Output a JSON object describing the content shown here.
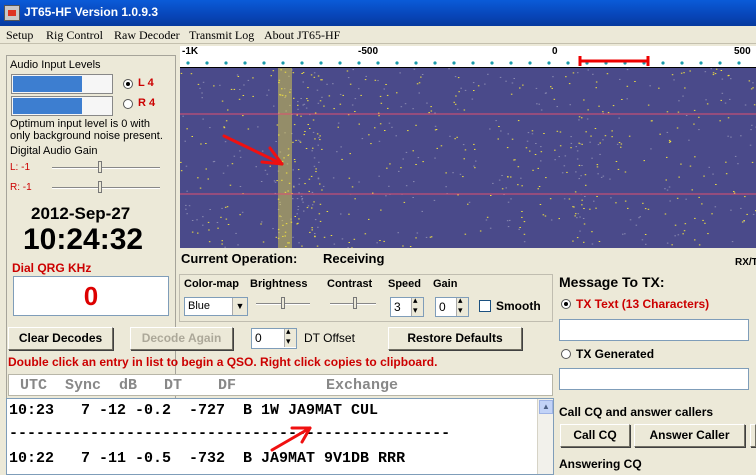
{
  "window": {
    "title": "JT65-HF Version 1.0.9.3"
  },
  "menu": [
    "Setup",
    "Rig Control",
    "Raw Decoder",
    "Transmit Log",
    "About JT65-HF"
  ],
  "audio": {
    "group_label": "Audio Input Levels",
    "left_level": "L 4",
    "right_level": "R 4",
    "left_fill_percent": 70,
    "right_fill_percent": 70,
    "note": "Optimum input level is 0 with only background noise present.",
    "gain_label": "Digital Audio Gain",
    "gain_left": "L: -1",
    "gain_right": "R: -1"
  },
  "clock": {
    "date": "2012-Sep-27",
    "time": "10:24:32"
  },
  "dial": {
    "label": "Dial QRG KHz",
    "value": "0"
  },
  "scale": {
    "ticks": [
      "-1K",
      "-500",
      "0",
      "500"
    ]
  },
  "status": {
    "label": "Current Operation:",
    "value": "Receiving",
    "rxtx": "RX/T"
  },
  "controls": {
    "colormap_label": "Color-map",
    "colormap_value": "Blue",
    "brightness_label": "Brightness",
    "contrast_label": "Contrast",
    "speed_label": "Speed",
    "speed_value": "3",
    "gain_label": "Gain",
    "gain_value": "0",
    "smooth_label": "Smooth"
  },
  "buttons": {
    "clear_decodes": "Clear Decodes",
    "decode_again": "Decode Again",
    "dt_offset_value": "0",
    "dt_offset_label": "DT Offset",
    "restore_defaults": "Restore Defaults",
    "call_cq": "Call CQ",
    "answer_caller": "Answer Caller"
  },
  "hint": "Double click an entry in list to begin a QSO.  Right click copies to clipboard.",
  "decodes": {
    "header": " UTC  Sync  dB   DT    DF          Exchange",
    "rows": [
      "10:23   7 -12 -0.2  -727  B 1W JA9MAT CUL",
      "-------------------------------------------------",
      "10:22   7 -11 -0.5  -732  B JA9MAT 9V1DB RRR"
    ]
  },
  "tx": {
    "title": "Message To TX:",
    "tx_text_label": "TX Text (13 Characters)",
    "tx_generated_label": "TX Generated",
    "cq_caption": "Call CQ and answer callers",
    "answering_cq": "Answering CQ"
  },
  "colors": {
    "accent_red": "#cc0000",
    "level_blue": "#3d7ed0",
    "waterfall_bg": "#4a4a8a",
    "signal_yellow": "#f0e040"
  }
}
